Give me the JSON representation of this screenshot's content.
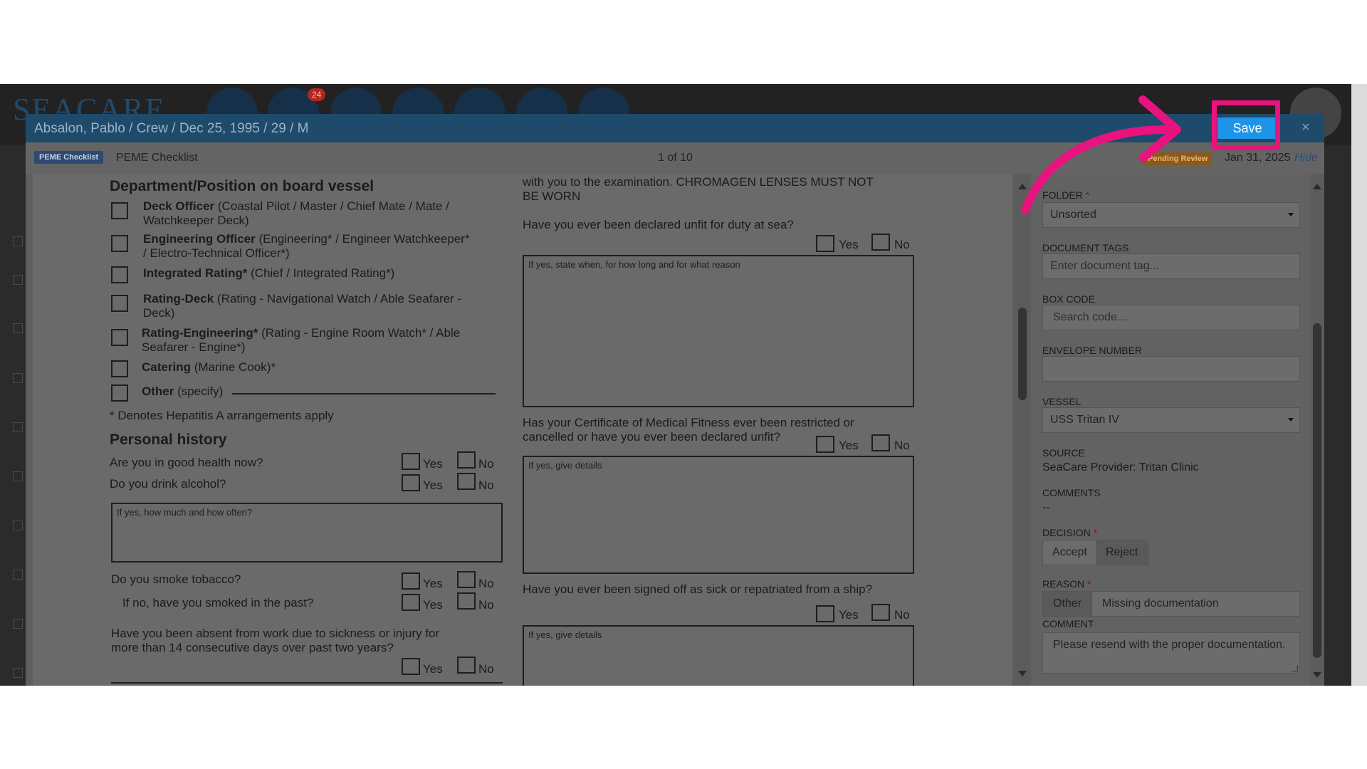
{
  "app": {
    "logo": "SEACARE",
    "notification_count": "24"
  },
  "modal": {
    "title": "Absalon, Pablo / Crew / Dec 25, 1995 / 29 / M",
    "save_label": "Save",
    "close_label": "×"
  },
  "subbar": {
    "badge": "PEME Checklist",
    "title": "PEME Checklist",
    "page_indicator": "1 of 10",
    "status": "Pending Review",
    "date": "Jan 31, 2025",
    "hide_label": "Hide"
  },
  "document": {
    "dept_heading": "Department/Position on board vessel",
    "positions": [
      {
        "bold": "Deck Officer",
        "rest": " (Coastal Pilot / Master / Chief Mate / Mate /",
        "line2": "Watchkeeper Deck)"
      },
      {
        "bold": "Engineering Officer",
        "rest": " (Engineering* / Engineer Watchkeeper*",
        "line2": "/ Electro-Technical Officer*)"
      },
      {
        "bold": "Integrated Rating*",
        "rest": " (Chief / Integrated Rating*)",
        "line2": ""
      },
      {
        "bold": "Rating-Deck",
        "rest": " (Rating - Navigational Watch / Able Seafarer -",
        "line2": "Deck)"
      },
      {
        "bold": "Rating-Engineering*",
        "rest": " (Rating - Engine Room Watch* / Able",
        "line2": "Seafarer - Engine*)"
      },
      {
        "bold": "Catering",
        "rest": " (Marine Cook)*",
        "line2": ""
      },
      {
        "bold": "Other",
        "rest": " (specify)",
        "line2": ""
      }
    ],
    "footnote": "* Denotes Hepatitis A arrangements apply",
    "personal_heading": "Personal history",
    "yes": "Yes",
    "no": "No",
    "q_health": "Are you in good health now?",
    "q_alcohol": "Do you drink alcohol?",
    "box_alcohol": "If yes, how much and how often?",
    "q_tobacco": "Do you smoke tobacco?",
    "q_smoked_past": "If no, have you smoked in the past?",
    "q_absent_1": "Have you been absent from work due to sickness or injury for",
    "q_absent_2": "more than 14 consecutive days over past two years?",
    "lenses_1": "with you to the examination. CHROMAGEN LENSES MUST NOT",
    "lenses_2": "BE WORN",
    "q_unfit": "Have you ever been declared unfit for duty at sea?",
    "box_unfit": "If yes, state when, for how long and for what reason",
    "q_cert_1": "Has your Certificate of Medical Fitness ever been restricted or",
    "q_cert_2": "cancelled or have you ever been declared unfit?",
    "box_cert": "If yes, give details",
    "q_signed_off": "Have you ever been signed off as sick or repatriated from a ship?",
    "box_signed_off": "If yes, give details"
  },
  "form": {
    "folder": {
      "label": "FOLDER",
      "value": "Unsorted"
    },
    "tags": {
      "label": "DOCUMENT TAGS",
      "placeholder": "Enter document tag..."
    },
    "box_code": {
      "label": "BOX CODE",
      "placeholder": "Search code..."
    },
    "envelope": {
      "label": "ENVELOPE NUMBER",
      "value": ""
    },
    "vessel": {
      "label": "VESSEL",
      "value": "USS Tritan IV"
    },
    "source": {
      "label": "SOURCE",
      "value": "SeaCare Provider: Tritan Clinic"
    },
    "comments": {
      "label": "COMMENTS",
      "value": "--"
    },
    "decision": {
      "label": "DECISION",
      "options": [
        "Accept",
        "Reject"
      ],
      "selected": "Reject"
    },
    "reason": {
      "label": "REASON",
      "category": "Other",
      "value": "Missing documentation"
    },
    "comment": {
      "label": "COMMENT",
      "value": "Please resend with the proper documentation."
    },
    "required_mark": "*"
  },
  "colors": {
    "highlight": "#e8137f",
    "save_button": "#1d94e8",
    "header": "#1e4a6b"
  }
}
